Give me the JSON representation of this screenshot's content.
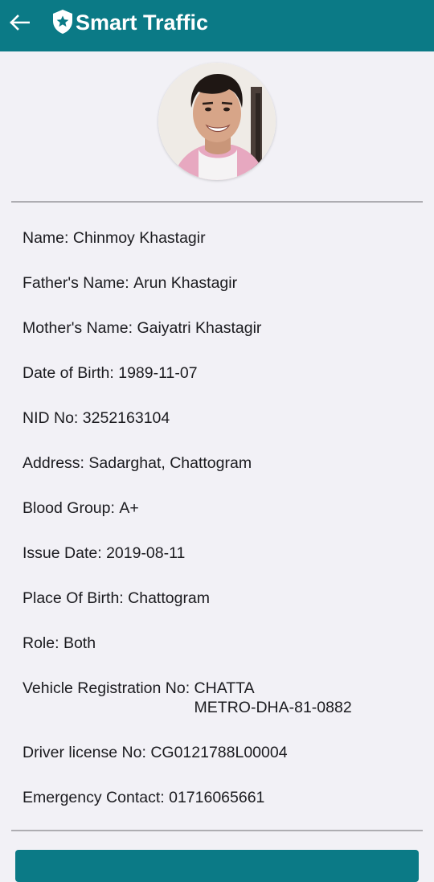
{
  "appbar": {
    "title": "Smart Traffic",
    "back_icon": "arrow-left-icon",
    "logo_icon": "star-shield-icon",
    "color": "#0b7a86"
  },
  "profile": {
    "photo_icon": "profile-photo",
    "fields": [
      {
        "label": "Name:",
        "value": "Chinmoy Khastagir"
      },
      {
        "label": "Father's Name:",
        "value": "Arun Khastagir"
      },
      {
        "label": "Mother's Name:",
        "value": "Gaiyatri Khastagir"
      },
      {
        "label": "Date of Birth:",
        "value": "1989-11-07"
      },
      {
        "label": "NID No:",
        "value": "3252163104"
      },
      {
        "label": "Address:",
        "value": "Sadarghat, Chattogram"
      },
      {
        "label": "Blood Group:",
        "value": "A+"
      },
      {
        "label": "Issue Date:",
        "value": "2019-08-11"
      },
      {
        "label": "Place Of Birth:",
        "value": "Chattogram"
      },
      {
        "label": "Role:",
        "value": "Both"
      },
      {
        "label": "Vehicle Registration No:",
        "value": "CHATTA\nMETRO-DHA-81-0882"
      },
      {
        "label": "Driver license No:",
        "value": "CG0121788L00004"
      },
      {
        "label": "Emergency Contact:",
        "value": "01716065661"
      }
    ]
  }
}
